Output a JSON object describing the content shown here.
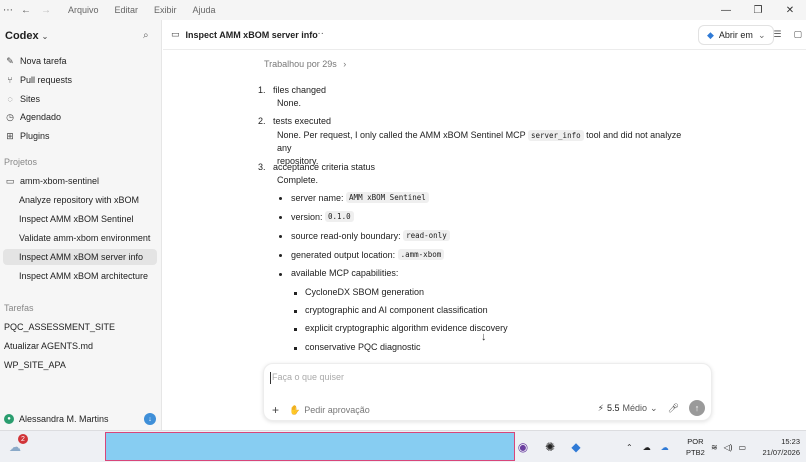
{
  "menu": [
    "Arquivo",
    "Editar",
    "Exibir",
    "Ajuda"
  ],
  "sidebar": {
    "brand": "Codex",
    "nav": [
      {
        "label": "Nova tarefa",
        "icon": "edit-icon"
      },
      {
        "label": "Pull requests",
        "icon": "pull-request-icon"
      },
      {
        "label": "Sites",
        "icon": "globe-icon"
      },
      {
        "label": "Agendado",
        "icon": "clock-icon"
      },
      {
        "label": "Plugins",
        "icon": "plugin-icon"
      }
    ],
    "projects_label": "Projetos",
    "project_name": "amm-xbom-sentinel",
    "project_items": [
      "Analyze repository with xBOM",
      "Inspect AMM xBOM Sentinel",
      "Validate amm-xbom environment",
      "Inspect AMM xBOM server info",
      "Inspect AMM xBOM architecture"
    ],
    "tasks_label": "Tarefas",
    "tasks": [
      "PQC_ASSESSMENT_SITE",
      "Atualizar AGENTS.md",
      "WP_SITE_APA"
    ],
    "user_name": "Alessandra M. Martins"
  },
  "header": {
    "title": "Inspect AMM xBOM server info",
    "more": "···",
    "open_in": "Abrir em"
  },
  "content": {
    "worked": "Trabalhou por 29s",
    "items": [
      {
        "num": "1.",
        "title": "files changed",
        "body": "None."
      },
      {
        "num": "2.",
        "title": "tests executed",
        "body_pre": "None. Per request, I only called the AMM xBOM Sentinel MCP ",
        "body_code": "server_info",
        "body_post": " tool and did not analyze any",
        "body_line2": "repository."
      },
      {
        "num": "3.",
        "title": "acceptance criteria status",
        "body": "Complete."
      }
    ],
    "bullets": [
      {
        "label": "server name: ",
        "code": "AMM xBOM Sentinel"
      },
      {
        "label": "version: ",
        "code": "0.1.0"
      },
      {
        "label": "source read-only boundary: ",
        "code": "read-only"
      },
      {
        "label": "generated output location: ",
        "code": ".amm-xbom"
      },
      {
        "label": "available MCP capabilities:",
        "code": ""
      }
    ],
    "sub_bullets": [
      "CycloneDX SBOM generation",
      "cryptographic and AI component classification",
      "explicit cryptographic algorithm evidence discovery",
      "conservative PQC diagnostic"
    ]
  },
  "composer": {
    "placeholder": "Faça o que quiser",
    "approval": "Pedir aprovação",
    "model": "5.5",
    "effort": "Médio"
  },
  "taskbar": {
    "badge_count": "2",
    "lang_line1": "POR",
    "lang_line2": "PTB2",
    "time": "15:23",
    "date": "21/07/2026"
  }
}
